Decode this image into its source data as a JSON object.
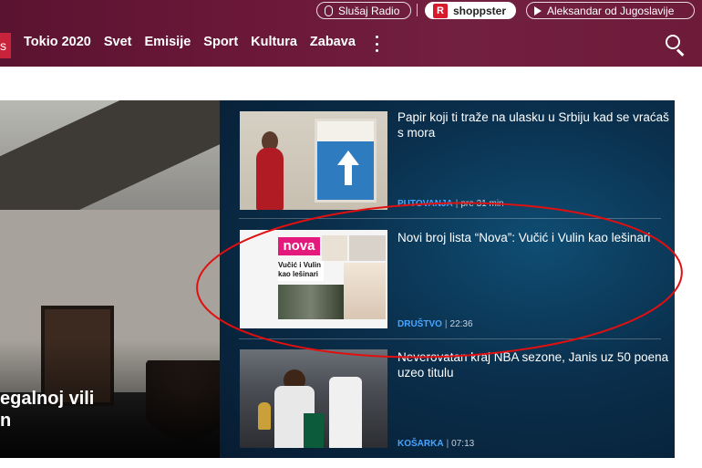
{
  "topbar": {
    "radio_label": "Slušaj Radio",
    "shop_label": "shoppster",
    "show_label": "Aleksandar od Jugoslavije"
  },
  "nav": {
    "brand_fragment": "s",
    "items": [
      "Tokio 2020",
      "Svet",
      "Emisije",
      "Sport",
      "Kultura",
      "Zabava"
    ]
  },
  "hero": {
    "title_lines": [
      "egalnoj vili",
      "n"
    ]
  },
  "news": [
    {
      "title": "Papir koji ti traže na ulasku u Srbiju kad se vraćaš s mora",
      "category": "PUTOVANJA",
      "time": "pre 31 min"
    },
    {
      "title": "Novi broj lista “Nova”: Vučić i Vulin kao lešinari",
      "category": "DRUŠTVO",
      "time": "22:36",
      "thumb_masthead": "nova",
      "thumb_headline": "Vučić i Vulin kao lešinari"
    },
    {
      "title": "Neverovatan kraj NBA sezone, Janis uz 50 poena uzeo titulu",
      "category": "KOŠARKA",
      "time": "07:13"
    }
  ],
  "icons": {
    "radio": "microphone-icon",
    "shop": "shoppster-logo-icon",
    "show": "play-icon",
    "more": "more-vertical-icon",
    "search": "search-icon"
  },
  "colors": {
    "header": "#6b1838",
    "panel": "#0a2f4c",
    "category": "#48a5ff",
    "annotation": "#e01010"
  }
}
